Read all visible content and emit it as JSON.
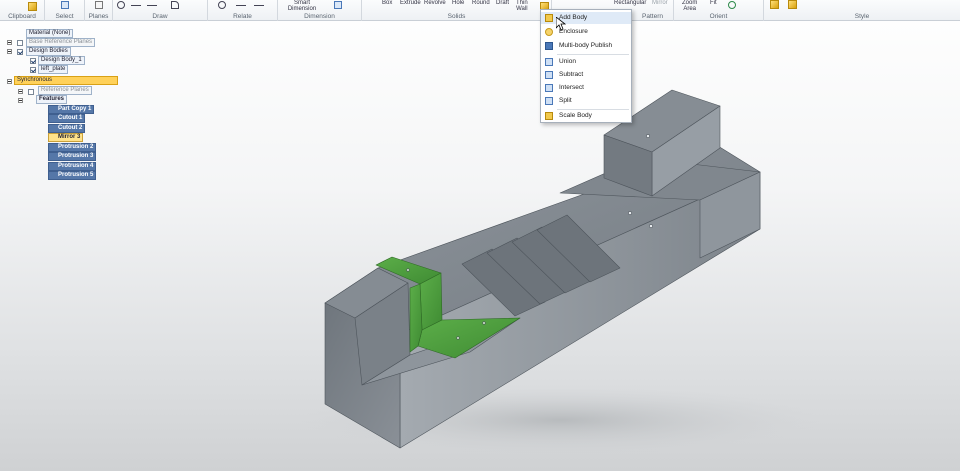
{
  "ribbon": {
    "groups": [
      {
        "label": "Clipboard"
      },
      {
        "label": "Select"
      },
      {
        "label": "Planes"
      },
      {
        "label": "Draw"
      },
      {
        "label": "Relate"
      },
      {
        "label": "Dimension"
      },
      {
        "label": "Solids"
      },
      {
        "label": "Pattern"
      },
      {
        "label": "Orient"
      },
      {
        "label": "Style"
      }
    ],
    "buttons": {
      "paste": "Paste",
      "select": "Select",
      "smart_dimension": "Smart\nDimension",
      "box": "Box",
      "extrude": "Extrude",
      "revolve": "Revolve",
      "hole": "Hole",
      "round": "Round",
      "draft": "Draft",
      "thin_wall": "Thin\nWall",
      "rectangular": "Rectangular",
      "mirror": "Mirror",
      "zoom_area": "Zoom\nArea",
      "fit": "Fit"
    }
  },
  "solids_menu": {
    "items": [
      {
        "label": "Add Body",
        "icon": "add-body-icon",
        "hover": true
      },
      {
        "label": "Enclosure",
        "icon": "enclosure-icon"
      },
      {
        "label": "Multi-body Publish",
        "icon": "multi-body-publish-icon"
      },
      {
        "label": "Union",
        "icon": "union-icon"
      },
      {
        "label": "Subtract",
        "icon": "subtract-icon"
      },
      {
        "label": "Intersect",
        "icon": "intersect-icon"
      },
      {
        "label": "Split",
        "icon": "split-icon"
      },
      {
        "label": "Scale Body",
        "icon": "scale-body-icon"
      }
    ]
  },
  "tree": {
    "material": "Material (None)",
    "base_planes": "Base Reference Planes",
    "design_bodies": "Design Bodies",
    "design_body_1": "Design Body_1",
    "left_plate": "left_plate",
    "synchronous": "Synchronous",
    "reference_planes": "Reference Planes",
    "features": "Features",
    "feature_items": [
      "Part Copy 1",
      "Cutout 1",
      "Cutout 2",
      "Mirror 3",
      "Protrusion 2",
      "Protrusion 3",
      "Protrusion 4",
      "Protrusion 5"
    ]
  },
  "colors": {
    "selection_green": "#4a9a3c",
    "model_gray": "#8c939a",
    "tree_highlight": "#ffd15a"
  }
}
